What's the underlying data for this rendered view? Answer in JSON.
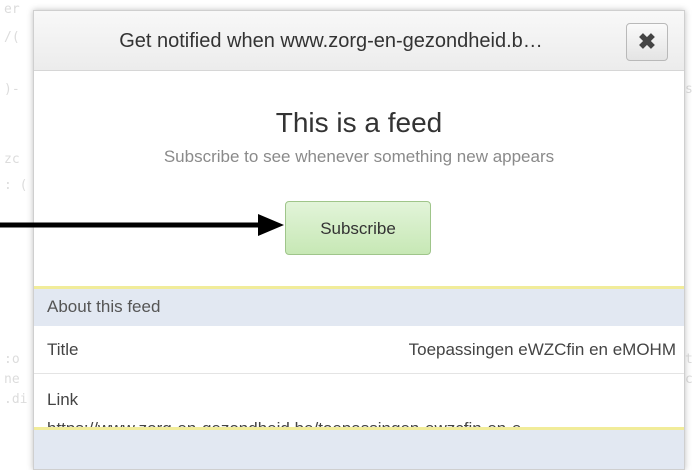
{
  "popup": {
    "title": "Get notified when www.zorg-en-gezondheid.b…",
    "close_symbol": "✖",
    "heading": "This is a feed",
    "subheading": "Subscribe to see whenever something new appears",
    "subscribe_label": "Subscribe"
  },
  "about": {
    "section_label": "About this feed",
    "title_label": "Title",
    "title_value": "Toepassingen eWZCfin en eMOHM",
    "link_label": "Link",
    "link_value": "https://www.zorg-en-gezondheid.be/toepassingen-ewzcfin-en-e…"
  },
  "icons": {
    "close": "close-icon",
    "arrow": "arrow-right-icon"
  },
  "colors": {
    "subscribe_bg": "#c7e8b5",
    "section_bg": "#e2e8f2",
    "section_border": "#f1ec9a"
  }
}
